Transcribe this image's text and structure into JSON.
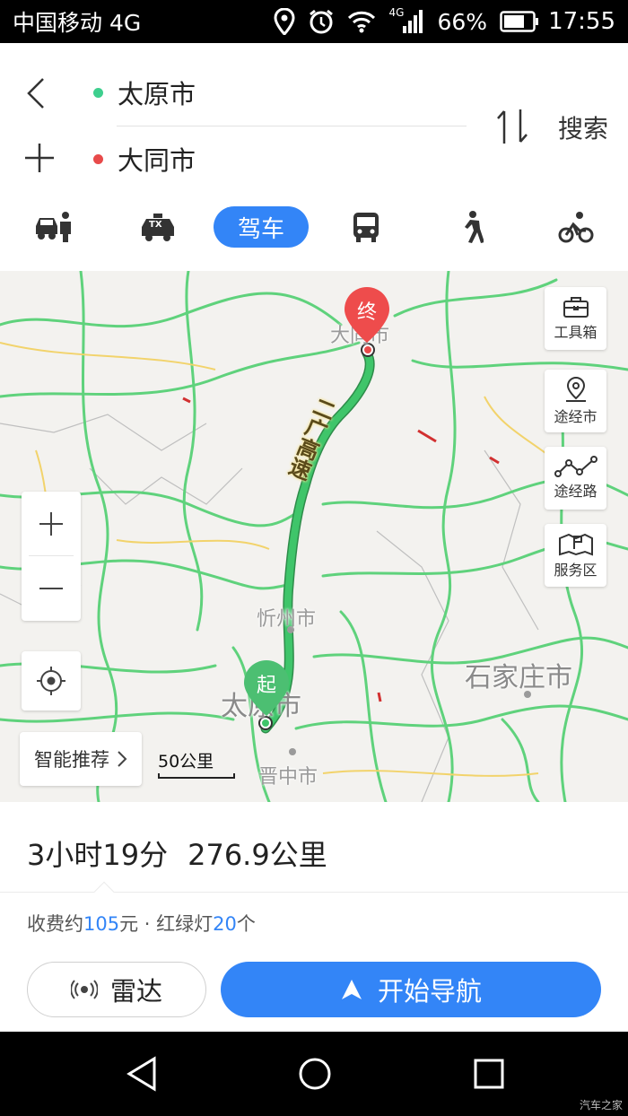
{
  "status_bar": {
    "carrier": "中国移动 4G",
    "network_label": "4G",
    "battery": "66%",
    "time": "17:55"
  },
  "route_search": {
    "from": "太原市",
    "to": "大同市",
    "search_label": "搜索",
    "colors": {
      "from_dot": "#3ecf8e",
      "to_dot": "#e84a4a"
    }
  },
  "modes": {
    "items": [
      "car-hailing-icon",
      "taxi-icon",
      "驾车",
      "bus-icon",
      "walk-icon",
      "bike-icon"
    ],
    "active": "驾车",
    "taxi_badge": "TX"
  },
  "map": {
    "cities": {
      "destination": "大同市",
      "xinzhou": "忻州市",
      "origin": "太原市",
      "shijiazhuang": "石家庄市",
      "jinzhong": "晋中市"
    },
    "road_label": "二广高速",
    "end_marker": "终",
    "start_marker": "起",
    "tools": [
      "工具箱",
      "途经市",
      "途经路",
      "服务区"
    ],
    "recommend": "智能推荐",
    "scale": "50公里",
    "colors": {
      "route": "#3fc56a",
      "start_marker": "#4cbf72",
      "end_marker": "#ee4c4c",
      "road": "#5fd27c",
      "highway": "#f2d36b"
    }
  },
  "summary": {
    "duration": "3小时19分",
    "distance": "276.9公里",
    "toll_prefix": "收费约",
    "toll_value": "105",
    "toll_suffix": "元 · 红绿灯",
    "lights_value": "20",
    "lights_suffix": "个"
  },
  "actions": {
    "radar": "雷达",
    "navigate": "开始导航"
  },
  "watermark": "汽车之家"
}
